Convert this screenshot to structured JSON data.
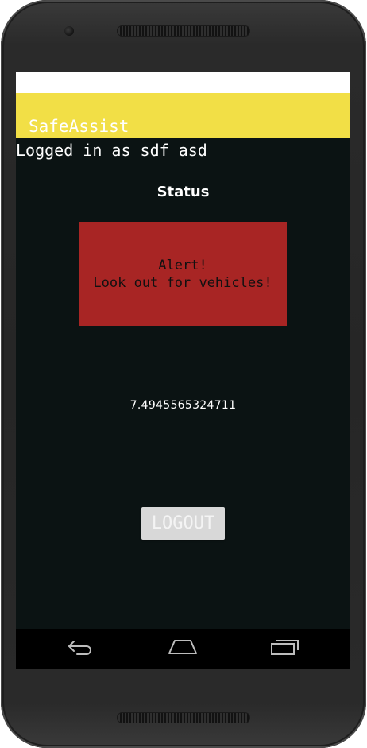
{
  "app": {
    "title": "SafeAssist"
  },
  "session": {
    "logged_in_text": "Logged in as sdf asd"
  },
  "status": {
    "heading": "Status",
    "alert_line1": "Alert!",
    "alert_line2": "Look out for vehicles!",
    "alert_color": "#a82524",
    "value": "7.4945565324711"
  },
  "actions": {
    "logout_label": "LOGOUT"
  },
  "navbar": {
    "back_icon": "back-arrow-icon",
    "home_icon": "home-icon",
    "recents_icon": "recents-icon"
  },
  "theme": {
    "appbar_color": "#f2df46",
    "background_color": "#0b1313"
  }
}
